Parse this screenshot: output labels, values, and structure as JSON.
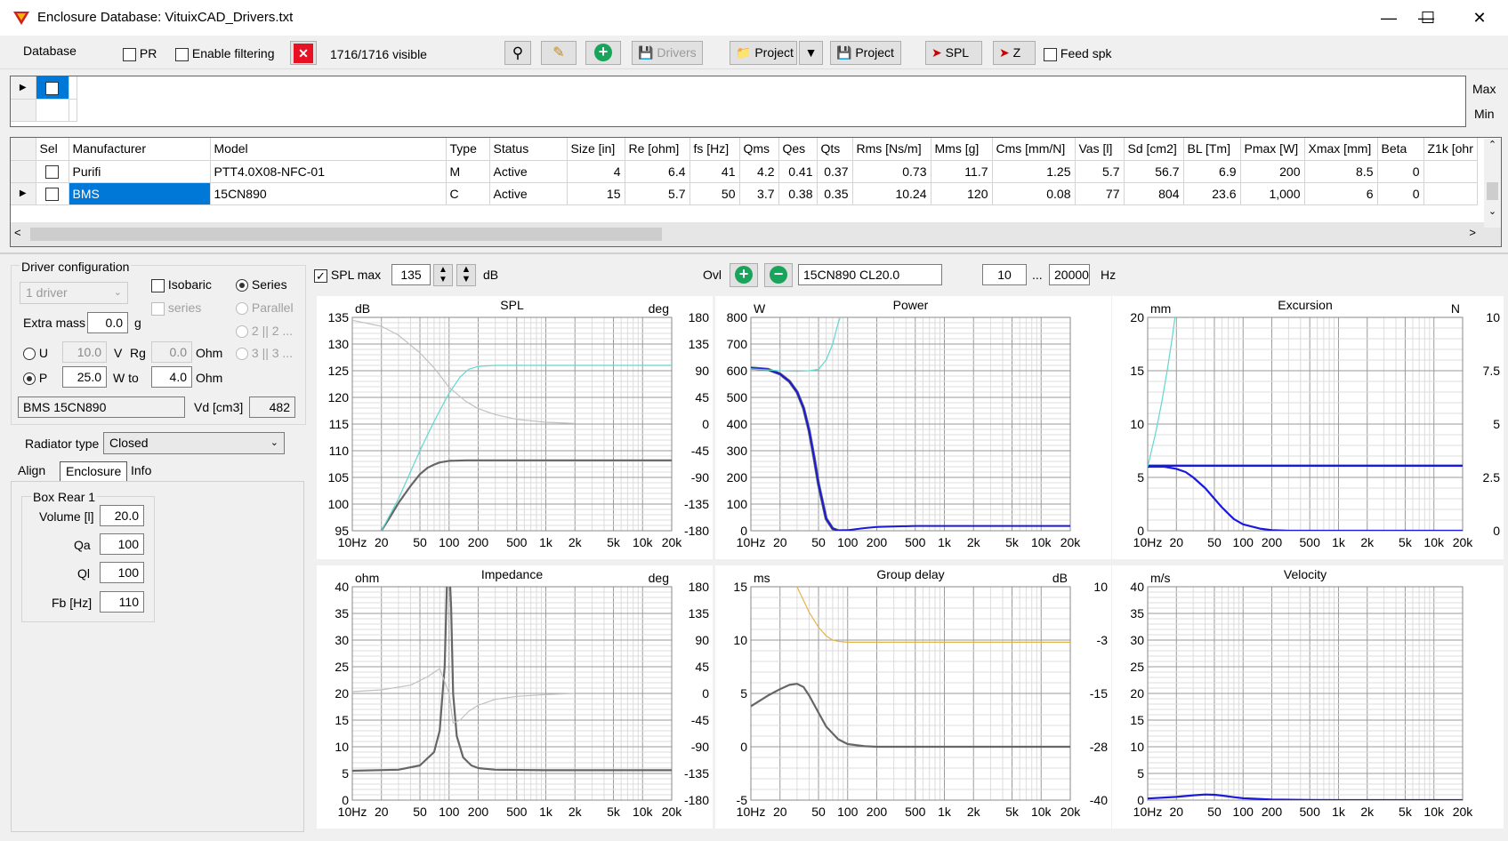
{
  "window": {
    "title": "Enclosure  Database: VituixCAD_Drivers.txt"
  },
  "toolbar": {
    "database_label": "Database",
    "pr_label": "PR",
    "enable_filtering_label": "Enable filtering",
    "visible_count": "1716/1716 visible",
    "drivers_label": "Drivers",
    "project_open_label": "Project",
    "project_save_label": "Project",
    "spl_label": "SPL",
    "z_label": "Z",
    "feed_spk_label": "Feed spk"
  },
  "filter": {
    "max_label": "Max",
    "min_label": "Min"
  },
  "table": {
    "columns": [
      "Sel",
      "Manufacturer",
      "Model",
      "Type",
      "Status",
      "Size [in]",
      "Re [ohm]",
      "fs [Hz]",
      "Qms",
      "Qes",
      "Qts",
      "Rms [Ns/m]",
      "Mms [g]",
      "Cms [mm/N]",
      "Vas [l]",
      "Sd [cm2]",
      "BL [Tm]",
      "Pmax [W]",
      "Xmax [mm]",
      "Beta",
      "Z1k [ohr"
    ],
    "rows": [
      [
        "",
        "Purifi",
        "PTT4.0X08-NFC-01",
        "M",
        "Active",
        "4",
        "6.4",
        "41",
        "4.2",
        "0.41",
        "0.37",
        "0.73",
        "11.7",
        "1.25",
        "5.7",
        "56.7",
        "6.9",
        "200",
        "8.5",
        "0",
        ""
      ],
      [
        "",
        "BMS",
        "15CN890",
        "C",
        "Active",
        "15",
        "5.7",
        "50",
        "3.7",
        "0.38",
        "0.35",
        "10.24",
        "120",
        "0.08",
        "77",
        "804",
        "23.6",
        "1,000",
        "6",
        "0",
        ""
      ]
    ]
  },
  "driver_config": {
    "title": "Driver configuration",
    "drivers_select": "1 driver",
    "isobaric_label": "Isobaric",
    "series_label": "Series",
    "series_sub_label": "series",
    "parallel_label": "Parallel",
    "two_label": "2 || 2 ...",
    "three_label": "3 || 3 ...",
    "extra_mass_label": "Extra mass",
    "extra_mass_value": "0.0",
    "extra_mass_unit": "g",
    "u_label": "U",
    "u_value": "10.0",
    "u_unit": "V",
    "rg_label": "Rg",
    "rg_value": "0.0",
    "rg_unit": "Ohm",
    "p_label": "P",
    "p_value": "25.0",
    "w_to_label": "W to",
    "w_to_value": "4.0",
    "w_to_unit": "Ohm",
    "driver_name": "BMS 15CN890",
    "vd_label": "Vd [cm3]",
    "vd_value": "482",
    "radiator_type_label": "Radiator type",
    "radiator_type_value": "Closed"
  },
  "tabs": [
    "Align",
    "Enclosure",
    "Info"
  ],
  "box": {
    "title": "Box Rear 1",
    "volume_label": "Volume [l]",
    "volume_value": "20.0",
    "qa_label": "Qa",
    "qa_value": "100",
    "ql_label": "Ql",
    "ql_value": "100",
    "fb_label": "Fb [Hz]",
    "fb_value": "110"
  },
  "plot_controls": {
    "spl_max_label": "SPL max",
    "spl_max_value": "135",
    "db_label": "dB",
    "ovl_label": "Ovl",
    "overlay_name": "15CN890 CL20.0",
    "freq_min": "10",
    "ellipsis": "...",
    "freq_max": "20000",
    "hz_label": "Hz"
  },
  "colors": {
    "cyan": "#5fd8d0",
    "blue": "#1a1adc",
    "dark": "#666666",
    "light": "#c0c0c0",
    "orange": "#e2b54a",
    "selection": "#0078d7"
  },
  "x_ticks": [
    "10Hz",
    "20",
    "50",
    "100",
    "200",
    "500",
    "1k",
    "2k",
    "5k",
    "10k",
    "20k"
  ],
  "chart_data": [
    {
      "type": "line",
      "title": "SPL",
      "left_unit": "dB",
      "right_unit": "deg",
      "ylim": [
        95,
        135
      ],
      "y_ticks": [
        "135",
        "130",
        "125",
        "120",
        "115",
        "110",
        "105",
        "100",
        "95"
      ],
      "y2lim": [
        -180,
        180
      ],
      "y2_ticks": [
        "180",
        "135",
        "90",
        "45",
        "0",
        "-45",
        "-90",
        "-135",
        "-180"
      ],
      "series": [
        {
          "color": "#666666",
          "width": 2.2,
          "axis": "y",
          "x": [
            20,
            25,
            30,
            40,
            50,
            60,
            70,
            80,
            100,
            150,
            200,
            500,
            1000,
            20000
          ],
          "y": [
            95,
            97.8,
            100.2,
            103.4,
            105.6,
            106.8,
            107.4,
            107.8,
            108.1,
            108.2,
            108.2,
            108.2,
            108.2,
            108.2
          ]
        },
        {
          "color": "#5fd8d0",
          "width": 1.2,
          "axis": "y",
          "x": [
            20,
            30,
            50,
            70,
            100,
            130,
            160,
            200,
            300,
            1000,
            20000
          ],
          "y": [
            95,
            101,
            110,
            115.5,
            120.8,
            123.8,
            125.3,
            125.8,
            126,
            126,
            126
          ]
        },
        {
          "color": "#c0c0c0",
          "width": 1.2,
          "axis": "y2",
          "x": [
            10,
            20,
            30,
            50,
            70,
            100,
            150,
            200,
            300,
            500,
            1000,
            2000
          ],
          "y": [
            175,
            165,
            150,
            120,
            95,
            62,
            38,
            26,
            16,
            8,
            3,
            1
          ]
        }
      ]
    },
    {
      "type": "line",
      "title": "Power",
      "left_unit": "W",
      "ylim": [
        0,
        800
      ],
      "y_ticks": [
        "800",
        "700",
        "600",
        "500",
        "400",
        "300",
        "200",
        "100",
        "0"
      ],
      "series": [
        {
          "color": "#666666",
          "width": 3.5,
          "x": [
            10,
            15,
            20,
            25,
            30,
            35,
            40,
            45,
            50,
            60,
            70,
            80,
            100
          ],
          "y": [
            610,
            605,
            588,
            560,
            520,
            460,
            375,
            275,
            175,
            45,
            8,
            0,
            0
          ]
        },
        {
          "color": "#1a1adc",
          "width": 2.0,
          "x": [
            10,
            15,
            20,
            25,
            30,
            35,
            40,
            45,
            50,
            60,
            70,
            80,
            100,
            150,
            200,
            500,
            1000,
            2000,
            5000,
            10000,
            20000
          ],
          "y": [
            610,
            605,
            588,
            560,
            520,
            460,
            375,
            275,
            175,
            45,
            8,
            0,
            2,
            10,
            14,
            18,
            18,
            18,
            18,
            18,
            18
          ]
        },
        {
          "color": "#5fd8d0",
          "width": 1.2,
          "x": [
            10,
            20,
            30,
            40,
            50,
            60,
            70,
            80,
            90
          ],
          "y": [
            607,
            600,
            598,
            600,
            605,
            640,
            700,
            780,
            830
          ]
        }
      ]
    },
    {
      "type": "line",
      "title": "Excursion",
      "left_unit": "mm",
      "right_unit": "N",
      "ylim": [
        0,
        20
      ],
      "y_ticks": [
        "20",
        "15",
        "10",
        "5",
        "0"
      ],
      "y2lim": [
        0,
        10
      ],
      "y2_ticks": [
        "10",
        "7.5",
        "5",
        "2.5",
        "0"
      ],
      "series": [
        {
          "color": "#1a1adc",
          "width": 2.2,
          "axis": "y",
          "x": [
            10,
            15,
            20,
            25,
            30,
            40,
            50,
            60,
            70,
            80,
            100,
            150,
            200,
            300,
            500,
            1000,
            20000
          ],
          "y": [
            6,
            6,
            5.8,
            5.5,
            5,
            4,
            3,
            2.2,
            1.6,
            1.1,
            0.6,
            0.2,
            0.05,
            0,
            0,
            0,
            0
          ]
        },
        {
          "color": "#1a1adc",
          "width": 2.4,
          "axis": "y2",
          "x": [
            10,
            20000
          ],
          "y": [
            3.05,
            3.05
          ]
        },
        {
          "color": "#5fd8d0",
          "width": 1.2,
          "axis": "y",
          "x": [
            10,
            12,
            14,
            16,
            18,
            20
          ],
          "y": [
            6,
            9,
            12,
            15,
            18,
            21
          ]
        }
      ]
    },
    {
      "type": "line",
      "title": "Impedance",
      "left_unit": "ohm",
      "right_unit": "deg",
      "ylim": [
        0,
        40
      ],
      "y_ticks": [
        "40",
        "35",
        "30",
        "25",
        "20",
        "15",
        "10",
        "5",
        "0"
      ],
      "y2lim": [
        -180,
        180
      ],
      "y2_ticks": [
        "180",
        "135",
        "90",
        "45",
        "0",
        "-45",
        "-90",
        "-135",
        "-180"
      ],
      "series": [
        {
          "color": "#666666",
          "width": 2.2,
          "axis": "y",
          "x": [
            10,
            30,
            50,
            70,
            80,
            90,
            95,
            100,
            105,
            110,
            120,
            140,
            170,
            200,
            300,
            1000,
            20000
          ],
          "y": [
            5.5,
            5.7,
            6.5,
            9,
            13,
            25,
            40,
            45,
            36,
            20,
            12,
            8,
            6.5,
            6,
            5.7,
            5.6,
            5.6
          ]
        },
        {
          "color": "#c0c0c0",
          "width": 1.2,
          "axis": "y2",
          "x": [
            10,
            20,
            40,
            60,
            80,
            100,
            110,
            130,
            160,
            200,
            300,
            500,
            1000,
            2000
          ],
          "y": [
            3,
            6,
            14,
            28,
            42,
            0,
            -50,
            -45,
            -30,
            -20,
            -10,
            -5,
            -2,
            0
          ]
        }
      ]
    },
    {
      "type": "line",
      "title": "Group delay",
      "left_unit": "ms",
      "right_unit": "dB",
      "ylim": [
        -5,
        15
      ],
      "y_ticks": [
        "15",
        "10",
        "5",
        "0",
        "-5"
      ],
      "y2lim": [
        -40,
        10
      ],
      "y2_ticks": [
        "10",
        "-3",
        "-15",
        "-28",
        "-40"
      ],
      "series": [
        {
          "color": "#666666",
          "width": 2.2,
          "axis": "y",
          "x": [
            10,
            15,
            20,
            25,
            30,
            35,
            40,
            50,
            60,
            80,
            100,
            150,
            200,
            500,
            1000,
            20000
          ],
          "y": [
            3.8,
            4.8,
            5.4,
            5.8,
            5.9,
            5.6,
            4.8,
            3.2,
            1.9,
            0.7,
            0.25,
            0.05,
            0,
            0,
            0,
            0
          ]
        },
        {
          "color": "#e2b54a",
          "width": 1.2,
          "axis": "y2",
          "x": [
            30,
            40,
            50,
            60,
            70,
            80,
            100,
            150,
            200,
            20000
          ],
          "y": [
            10,
            4,
            0.5,
            -1.5,
            -2.5,
            -2.8,
            -3,
            -3,
            -3,
            -3
          ]
        }
      ]
    },
    {
      "type": "line",
      "title": "Velocity",
      "left_unit": "m/s",
      "ylim": [
        0,
        40
      ],
      "y_ticks": [
        "40",
        "35",
        "30",
        "25",
        "20",
        "15",
        "10",
        "5",
        "0"
      ],
      "series": [
        {
          "color": "#1a1adc",
          "width": 2.2,
          "x": [
            10,
            20,
            30,
            40,
            50,
            60,
            80,
            100,
            200,
            500,
            1000,
            20000
          ],
          "y": [
            0.3,
            0.6,
            0.9,
            1.05,
            1.0,
            0.85,
            0.55,
            0.35,
            0.1,
            0.02,
            0,
            0
          ]
        }
      ]
    }
  ]
}
